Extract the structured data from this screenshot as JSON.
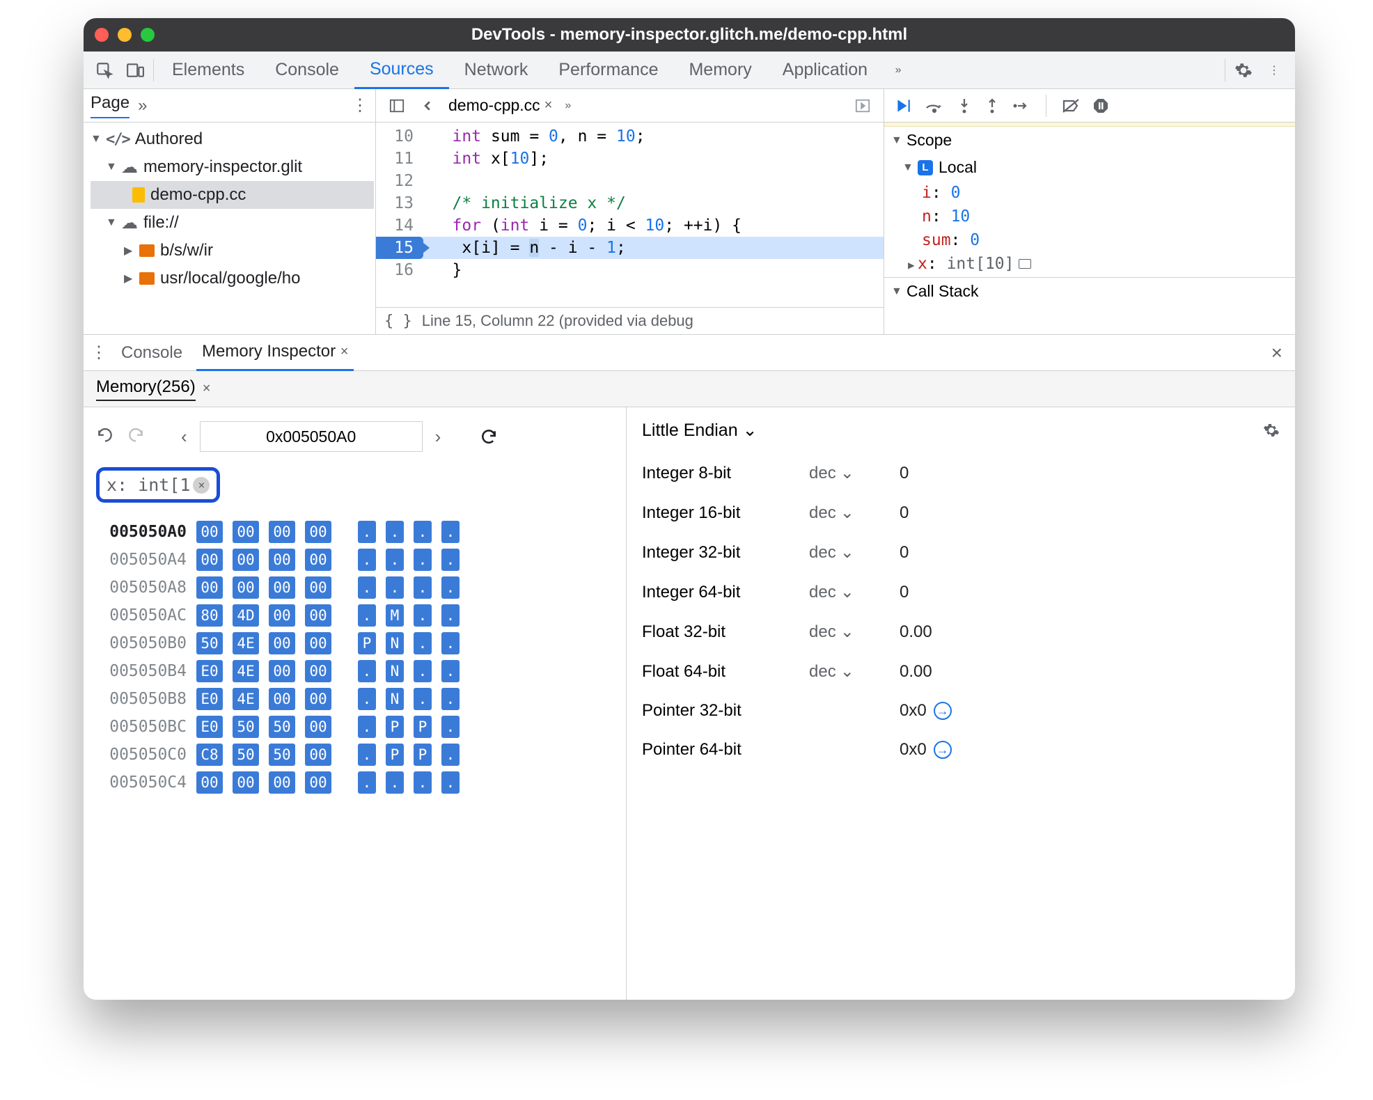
{
  "title": "DevTools - memory-inspector.glitch.me/demo-cpp.html",
  "tabs": [
    "Elements",
    "Console",
    "Sources",
    "Network",
    "Performance",
    "Memory",
    "Application"
  ],
  "activeTab": "Sources",
  "leftPane": {
    "tab": "Page"
  },
  "tree": {
    "authored": "Authored",
    "host": "memory-inspector.glit",
    "file": "demo-cpp.cc",
    "fileproto": "file://",
    "sub1": "b/s/w/ir",
    "sub2": "usr/local/google/ho"
  },
  "editor": {
    "tab": "demo-cpp.cc",
    "lines": [
      {
        "n": 10,
        "html": "<span class='kw'>int</span> sum = <span class='num'>0</span>, n = <span class='num'>10</span>;"
      },
      {
        "n": 11,
        "html": "<span class='kw'>int</span> x[<span class='num'>10</span>];"
      },
      {
        "n": 12,
        "html": ""
      },
      {
        "n": 13,
        "html": "<span class='cm'>/* initialize x */</span>"
      },
      {
        "n": 14,
        "html": "<span class='kw'>for</span> (<span class='kw'>int</span> i = <span class='num'>0</span>; i &lt; <span class='num'>10</span>; ++i) {"
      },
      {
        "n": 15,
        "html": " x[i] = <span class='sel-tok'>n</span> - i - <span class='num'>1</span>;",
        "hl": true
      },
      {
        "n": 16,
        "html": "}"
      }
    ],
    "status": "Line 15, Column 22 (provided via debug"
  },
  "scope": {
    "title": "Scope",
    "local": "Local",
    "vars": [
      {
        "n": "i",
        "v": "0"
      },
      {
        "n": "n",
        "v": "10"
      },
      {
        "n": "sum",
        "v": "0"
      },
      {
        "n": "x",
        "t": "int[10]",
        "arrow": true
      }
    ],
    "callstack": "Call Stack"
  },
  "drawer": {
    "console": "Console",
    "inspector": "Memory Inspector",
    "sub": "Memory(256)"
  },
  "mem": {
    "address": "0x005050A0",
    "chip": "x: int[1",
    "rows": [
      {
        "a": "005050A0",
        "b": [
          "00",
          "00",
          "00",
          "00"
        ],
        "c": [
          ".",
          ".",
          ".",
          "."
        ]
      },
      {
        "a": "005050A4",
        "b": [
          "00",
          "00",
          "00",
          "00"
        ],
        "c": [
          ".",
          ".",
          ".",
          "."
        ]
      },
      {
        "a": "005050A8",
        "b": [
          "00",
          "00",
          "00",
          "00"
        ],
        "c": [
          ".",
          ".",
          ".",
          "."
        ]
      },
      {
        "a": "005050AC",
        "b": [
          "80",
          "4D",
          "00",
          "00"
        ],
        "c": [
          ".",
          "M",
          ".",
          "."
        ]
      },
      {
        "a": "005050B0",
        "b": [
          "50",
          "4E",
          "00",
          "00"
        ],
        "c": [
          "P",
          "N",
          ".",
          "."
        ]
      },
      {
        "a": "005050B4",
        "b": [
          "E0",
          "4E",
          "00",
          "00"
        ],
        "c": [
          ".",
          "N",
          ".",
          "."
        ]
      },
      {
        "a": "005050B8",
        "b": [
          "E0",
          "4E",
          "00",
          "00"
        ],
        "c": [
          ".",
          "N",
          ".",
          "."
        ]
      },
      {
        "a": "005050BC",
        "b": [
          "E0",
          "50",
          "50",
          "00"
        ],
        "c": [
          ".",
          "P",
          "P",
          "."
        ]
      },
      {
        "a": "005050C0",
        "b": [
          "C8",
          "50",
          "50",
          "00"
        ],
        "c": [
          ".",
          "P",
          "P",
          "."
        ]
      },
      {
        "a": "005050C4",
        "b": [
          "00",
          "00",
          "00",
          "00"
        ],
        "c": [
          ".",
          ".",
          ".",
          "."
        ]
      }
    ]
  },
  "endianLabel": "Little Endian",
  "values": [
    {
      "l": "Integer 8-bit",
      "f": "dec",
      "v": "0"
    },
    {
      "l": "Integer 16-bit",
      "f": "dec",
      "v": "0"
    },
    {
      "l": "Integer 32-bit",
      "f": "dec",
      "v": "0"
    },
    {
      "l": "Integer 64-bit",
      "f": "dec",
      "v": "0"
    },
    {
      "l": "Float 32-bit",
      "f": "dec",
      "v": "0.00"
    },
    {
      "l": "Float 64-bit",
      "f": "dec",
      "v": "0.00"
    },
    {
      "l": "Pointer 32-bit",
      "f": "",
      "v": "0x0",
      "goto": true
    },
    {
      "l": "Pointer 64-bit",
      "f": "",
      "v": "0x0",
      "goto": true
    }
  ]
}
